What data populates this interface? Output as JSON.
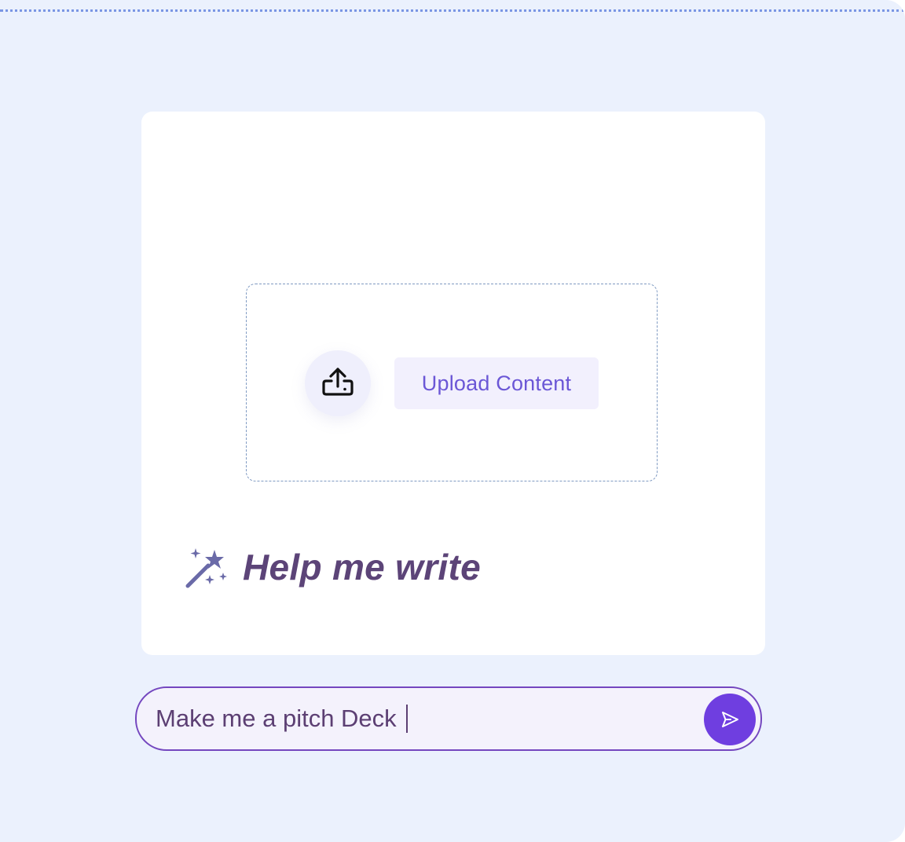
{
  "upload": {
    "button_label": "Upload Content",
    "icon": "upload-icon"
  },
  "assistant": {
    "help_label": "Help me write",
    "icon": "magic-wand-icon"
  },
  "chat": {
    "input_value": "Make me a pitch Deck",
    "send_icon": "send-icon"
  },
  "colors": {
    "background": "#ebf1fd",
    "accent": "#6f3ee0",
    "upload_text": "#6b57d6",
    "heading": "#5c4478"
  }
}
